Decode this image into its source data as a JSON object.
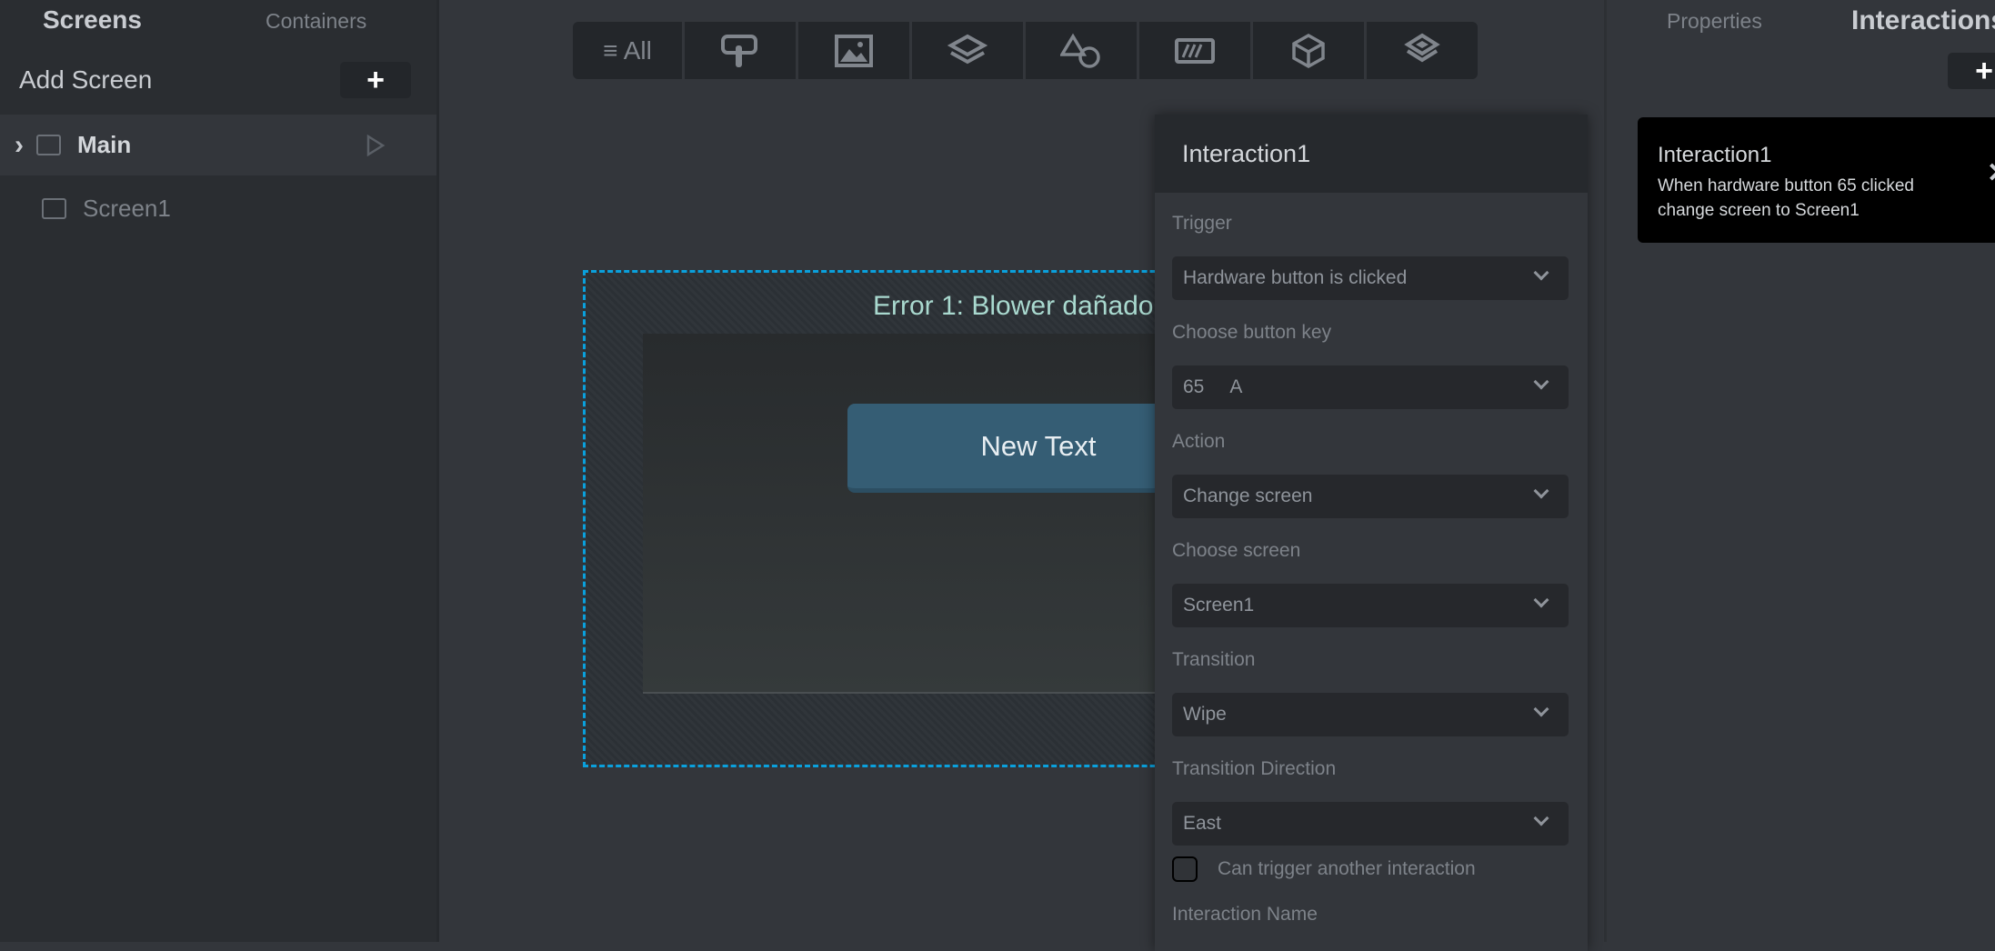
{
  "sidebar": {
    "tabs": {
      "screens": "Screens",
      "containers": "Containers"
    },
    "add_screen": "Add Screen",
    "plus": "+",
    "screens": [
      {
        "name": "Main"
      },
      {
        "name": "Screen1"
      }
    ],
    "chevron": "›"
  },
  "toolbar": {
    "all_label": "≡ All",
    "icons": [
      "touch-icon",
      "image-icon",
      "layers-icon",
      "shapes-icon",
      "progress-icon",
      "cube-icon",
      "stack-icon"
    ]
  },
  "canvas": {
    "error_text": "Error 1: Blower dañado",
    "button_text": "New Text"
  },
  "interaction_panel": {
    "title": "Interaction1",
    "fields": [
      {
        "label": "Trigger",
        "value": "Hardware button is clicked"
      },
      {
        "label": "Choose button key",
        "value": "65     A"
      },
      {
        "label": "Action",
        "value": "Change screen"
      },
      {
        "label": "Choose screen",
        "value": "Screen1"
      },
      {
        "label": "Transition",
        "value": "Wipe"
      },
      {
        "label": "Transition Direction",
        "value": "East"
      }
    ],
    "checkbox_label": "Can trigger another interaction",
    "checkbox_checked": false,
    "name_label": "Interaction Name"
  },
  "right_panel": {
    "tabs": {
      "properties": "Properties",
      "interactions": "Interactions"
    },
    "plus": "+",
    "card": {
      "title": "Interaction1",
      "line1": "When hardware button 65 clicked",
      "line2": "change screen to Screen1",
      "close": "✕"
    }
  },
  "colors": {
    "selection": "#0aa0dc",
    "button": "#355d74"
  }
}
